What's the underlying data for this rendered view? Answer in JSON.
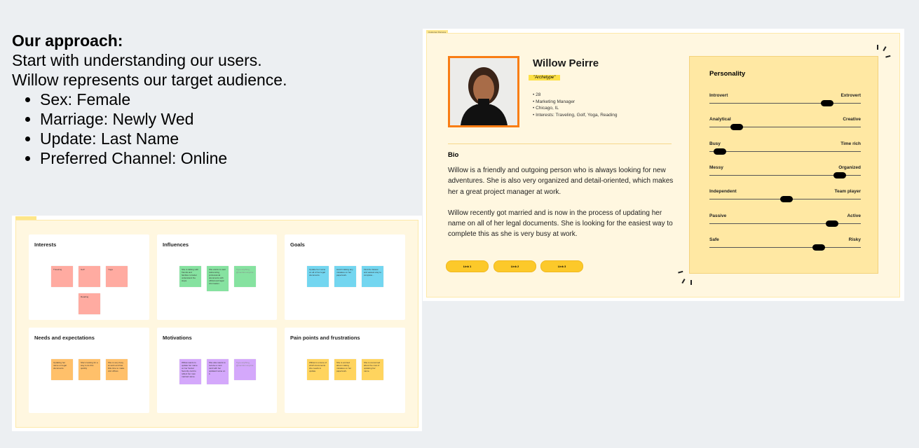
{
  "approach": {
    "title": "Our approach:",
    "lines": [
      "Start with understanding our users.",
      "Willow represents our target audience."
    ],
    "bullets": [
      "Sex: Female",
      "Marriage: Newly Wed",
      "Update: Last Name",
      "Preferred Channel: Online"
    ]
  },
  "persona": {
    "tag": "Customer Persona",
    "name": "Willow Peirre",
    "archetype": "\"Archetype\"",
    "facts": [
      "28",
      "Marketing Manager",
      "Chicago, IL",
      "Interests: Traveling, Golf, Yoga, Reading"
    ],
    "bio_heading": "Bio",
    "bio": [
      "Willow is a friendly and outgoing person who is always looking for new adventures. She is also very organized and detail-oriented, which makes her a great project manager at work.",
      "Willow recently got married and is now in the process of updating her name on all of her legal documents. She is looking for the easiest way to complete this as she is very busy at work."
    ],
    "links": [
      "Link 1",
      "Link 2",
      "Link 3"
    ],
    "personality": {
      "title": "Personality",
      "sliders": [
        {
          "left": "Introvert",
          "right": "Extrovert",
          "value": 0.78
        },
        {
          "left": "Analytical",
          "right": "Creative",
          "value": 0.18
        },
        {
          "left": "Busy",
          "right": "Time rich",
          "value": 0.07
        },
        {
          "left": "Messy",
          "right": "Organized",
          "value": 0.86
        },
        {
          "left": "Independent",
          "right": "Team player",
          "value": 0.51
        },
        {
          "left": "Passive",
          "right": "Active",
          "value": 0.81
        },
        {
          "left": "Safe",
          "right": "Risky",
          "value": 0.72
        }
      ]
    }
  },
  "board": {
    "tag": "",
    "colors": {
      "interests": "#ffaba1",
      "influences": "#86e2a0",
      "goals": "#73d6f0",
      "needs": "#ffc06a",
      "motivations": "#d4a8fb",
      "pain": "#ffd45e"
    },
    "sections": [
      {
        "title": "Interests",
        "color": "#ffaba1",
        "notes": [
          "Traveling",
          "Golf",
          "Yoga",
          "Reading"
        ]
      },
      {
        "title": "Influences",
        "color": "#86e2a0",
        "notes": [
          "She is talking with friends and families to better understand the steps.",
          "She wants to start referencing professional documents with official and legal information.",
          "Type anything, @mention anyone"
        ]
      },
      {
        "title": "Goals",
        "color": "#73d6f0",
        "notes": [
          "Update her name on all of her legal documents.",
          "Avoid making any mistakes on her paperwork.",
          "Find the fastest and easiest way to complete..."
        ]
      },
      {
        "title": "Needs and expectations",
        "color": "#ffc06a",
        "notes": [
          "Updating her name on legal documents",
          "She's looking for a way to do this quickly",
          "She is very busy at work and has little time to make visit offices"
        ]
      },
      {
        "title": "Motivations",
        "color": "#d4a8fb",
        "notes": [
          "Willow wants to update her name on her Social Security card to reflect her new married name.",
          "She also wants to receive a new card with her updated name on it.",
          "Type anything, @mention anyone"
        ]
      },
      {
        "title": "Pain points and frustrations",
        "color": "#ffd45e",
        "notes": [
          "Willow is unsure of which documents she needs to update.",
          "She is worried about making mistakes on her paperwork.",
          "She is concerned about the cost of updating her name."
        ]
      }
    ]
  }
}
